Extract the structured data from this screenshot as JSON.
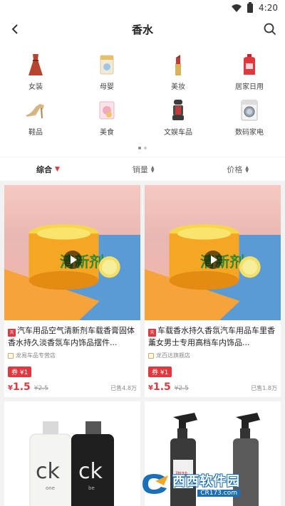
{
  "statusbar": {
    "time": "4:20"
  },
  "header": {
    "title": "香水"
  },
  "categories": [
    {
      "label": "女装",
      "icon": "dress-icon"
    },
    {
      "label": "母婴",
      "icon": "baby-formula-icon"
    },
    {
      "label": "美妆",
      "icon": "lipstick-icon"
    },
    {
      "label": "居家日用",
      "icon": "detergent-bottle-icon"
    },
    {
      "label": "鞋品",
      "icon": "high-heel-icon"
    },
    {
      "label": "美食",
      "icon": "snack-icon"
    },
    {
      "label": "文娱车品",
      "icon": "car-seat-icon"
    },
    {
      "label": "数码家电",
      "icon": "washing-machine-icon"
    }
  ],
  "sort": {
    "options": [
      {
        "label": "综合",
        "active": true
      },
      {
        "label": "销量",
        "active": false
      },
      {
        "label": "价格",
        "active": false
      }
    ]
  },
  "products": [
    {
      "title": "汽车用品空气清新剂车载香膏固体香水持久淡香氛车内饰品摆件...",
      "shop": "龙易车品专营店",
      "coupon": "券 ¥1",
      "price_currency": "¥",
      "price": "1.5",
      "original_price": "¥2.5",
      "sold": "已售4.8万",
      "jar_label": "清新剂"
    },
    {
      "title": "车载香水持久香氛汽车用品车里香薰女男士专用高档车内饰品...",
      "shop": "龙百达旗舰店",
      "coupon": "券 ¥1",
      "price_currency": "¥",
      "price": "1.5",
      "original_price": "¥2.5",
      "sold": "已售1.8万",
      "jar_label": "清新剂"
    }
  ],
  "lower_cards": [
    {
      "left_bottle_label": "ck",
      "left_bottle_sub": "one",
      "right_bottle_label": "ck",
      "right_bottle_sub": "be"
    },
    {
      "bottle_label": "驱味"
    }
  ],
  "watermark": {
    "main": "西西软件园",
    "sub": "CR173.com"
  },
  "colors": {
    "accent": "#e0383e",
    "watermark_blue": "#1a6fb8"
  }
}
